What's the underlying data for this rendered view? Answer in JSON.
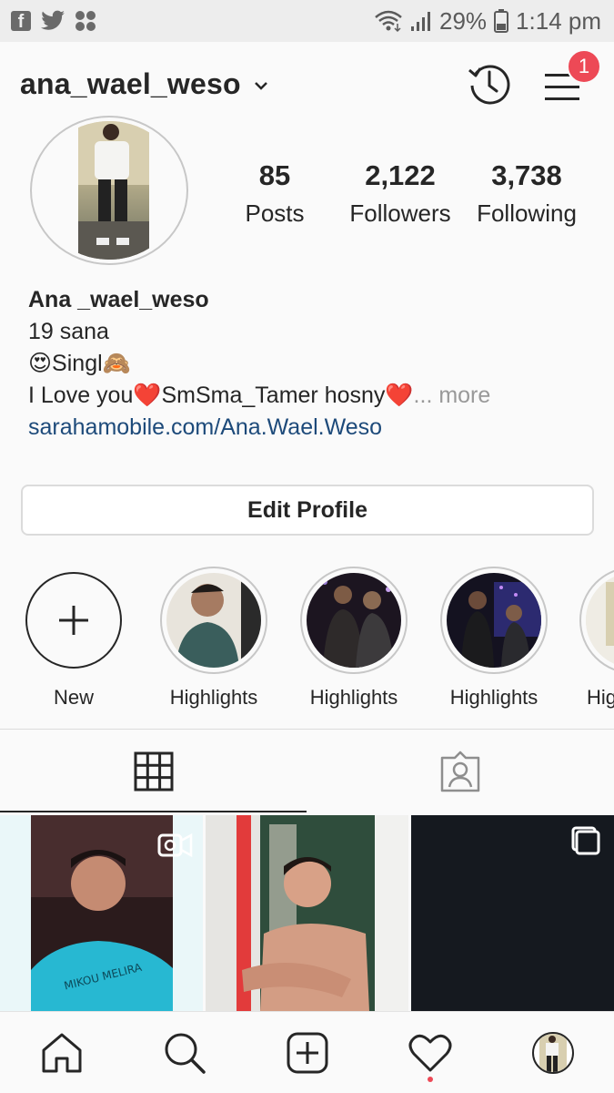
{
  "status_bar": {
    "battery": "29%",
    "time": "1:14 pm",
    "icons": [
      "facebook-icon",
      "twitter-icon",
      "app-grid-icon",
      "wifi-icon",
      "signal-icon",
      "battery-icon"
    ]
  },
  "header": {
    "username": "ana_wael_weso",
    "notification_count": "1"
  },
  "profile": {
    "stats": [
      {
        "value": "85",
        "label": "Posts"
      },
      {
        "value": "2,122",
        "label": "Followers"
      },
      {
        "value": "3,738",
        "label": "Following"
      }
    ],
    "bio": {
      "name": "Ana _wael_weso",
      "line1": "19 sana",
      "line2": "😍Singl🙈",
      "line3": "I Love you❤️SmSma_Tamer hosny❤️",
      "more": "... more",
      "link": "sarahamobile.com/Ana.Wael.Weso"
    },
    "edit_button": "Edit Profile"
  },
  "highlights": [
    {
      "label": "New"
    },
    {
      "label": "Highlights"
    },
    {
      "label": "Highlights"
    },
    {
      "label": "Highlights"
    },
    {
      "label": "Hig"
    }
  ],
  "colors": {
    "accent_red": "#ed4956",
    "text": "#262626",
    "link": "#1d4a7a",
    "muted": "#999999"
  }
}
